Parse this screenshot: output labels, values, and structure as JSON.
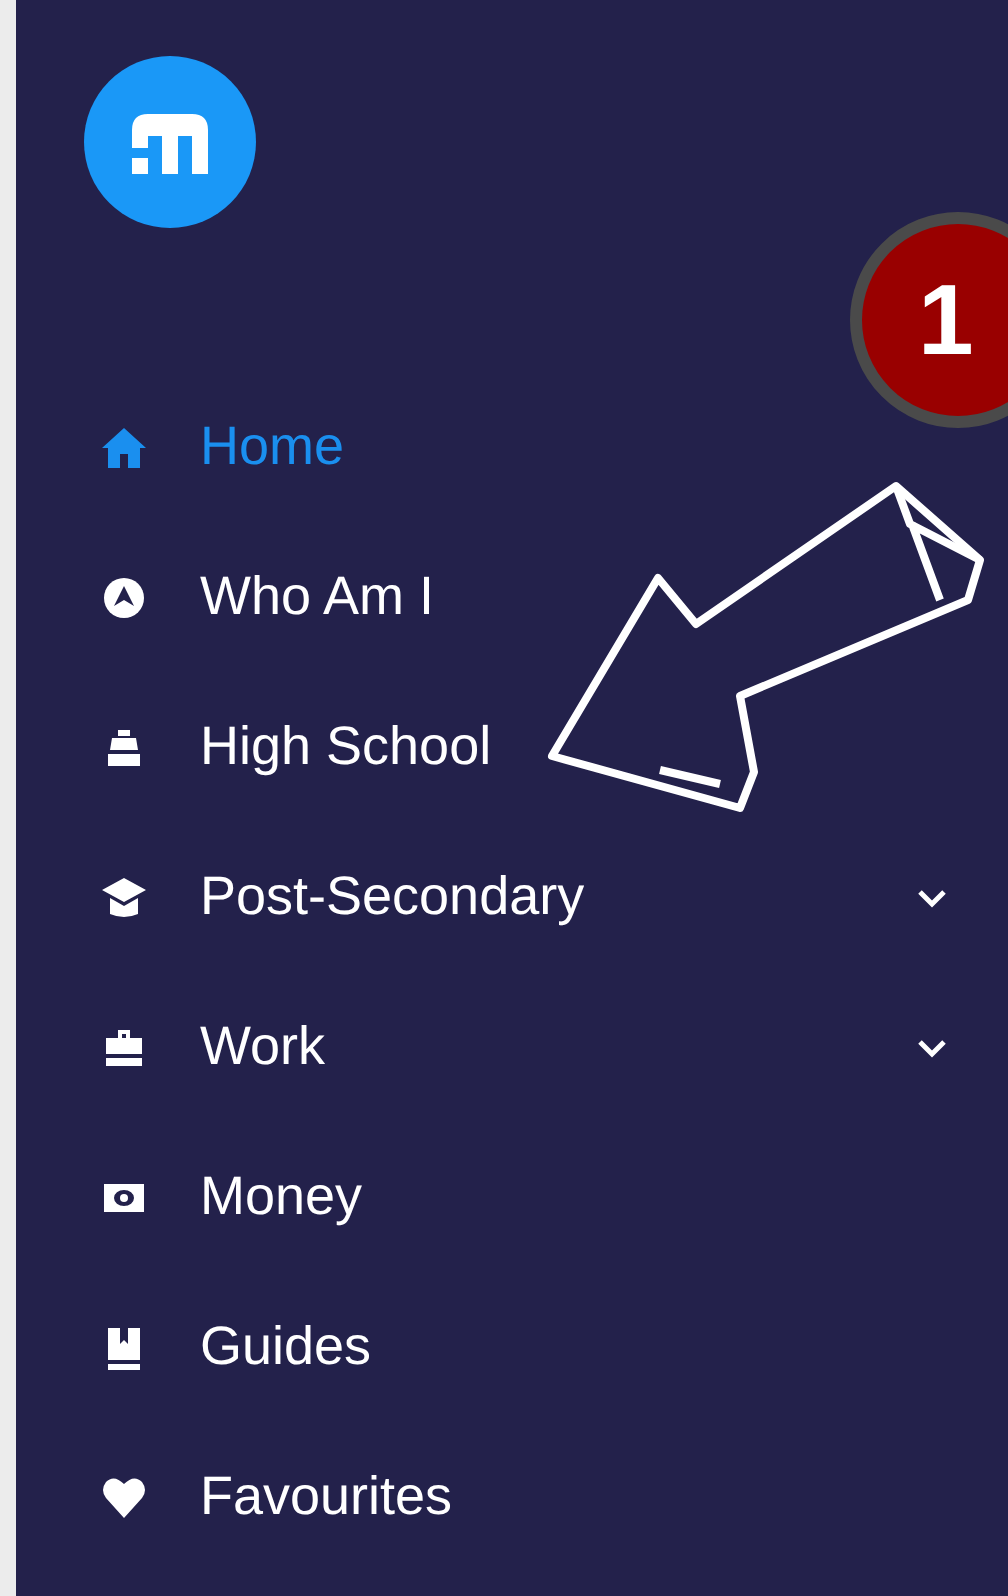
{
  "menu": [
    {
      "label": "Home",
      "selected": true,
      "expandable": false
    },
    {
      "label": "Who Am I",
      "selected": false,
      "expandable": false
    },
    {
      "label": "High School",
      "selected": false,
      "expandable": false
    },
    {
      "label": "Post-Secondary",
      "selected": false,
      "expandable": true
    },
    {
      "label": "Work",
      "selected": false,
      "expandable": true
    },
    {
      "label": "Money",
      "selected": false,
      "expandable": false
    },
    {
      "label": "Guides",
      "selected": false,
      "expandable": false
    },
    {
      "label": "Favourites",
      "selected": false,
      "expandable": false
    }
  ],
  "callout": {
    "number": "1"
  }
}
